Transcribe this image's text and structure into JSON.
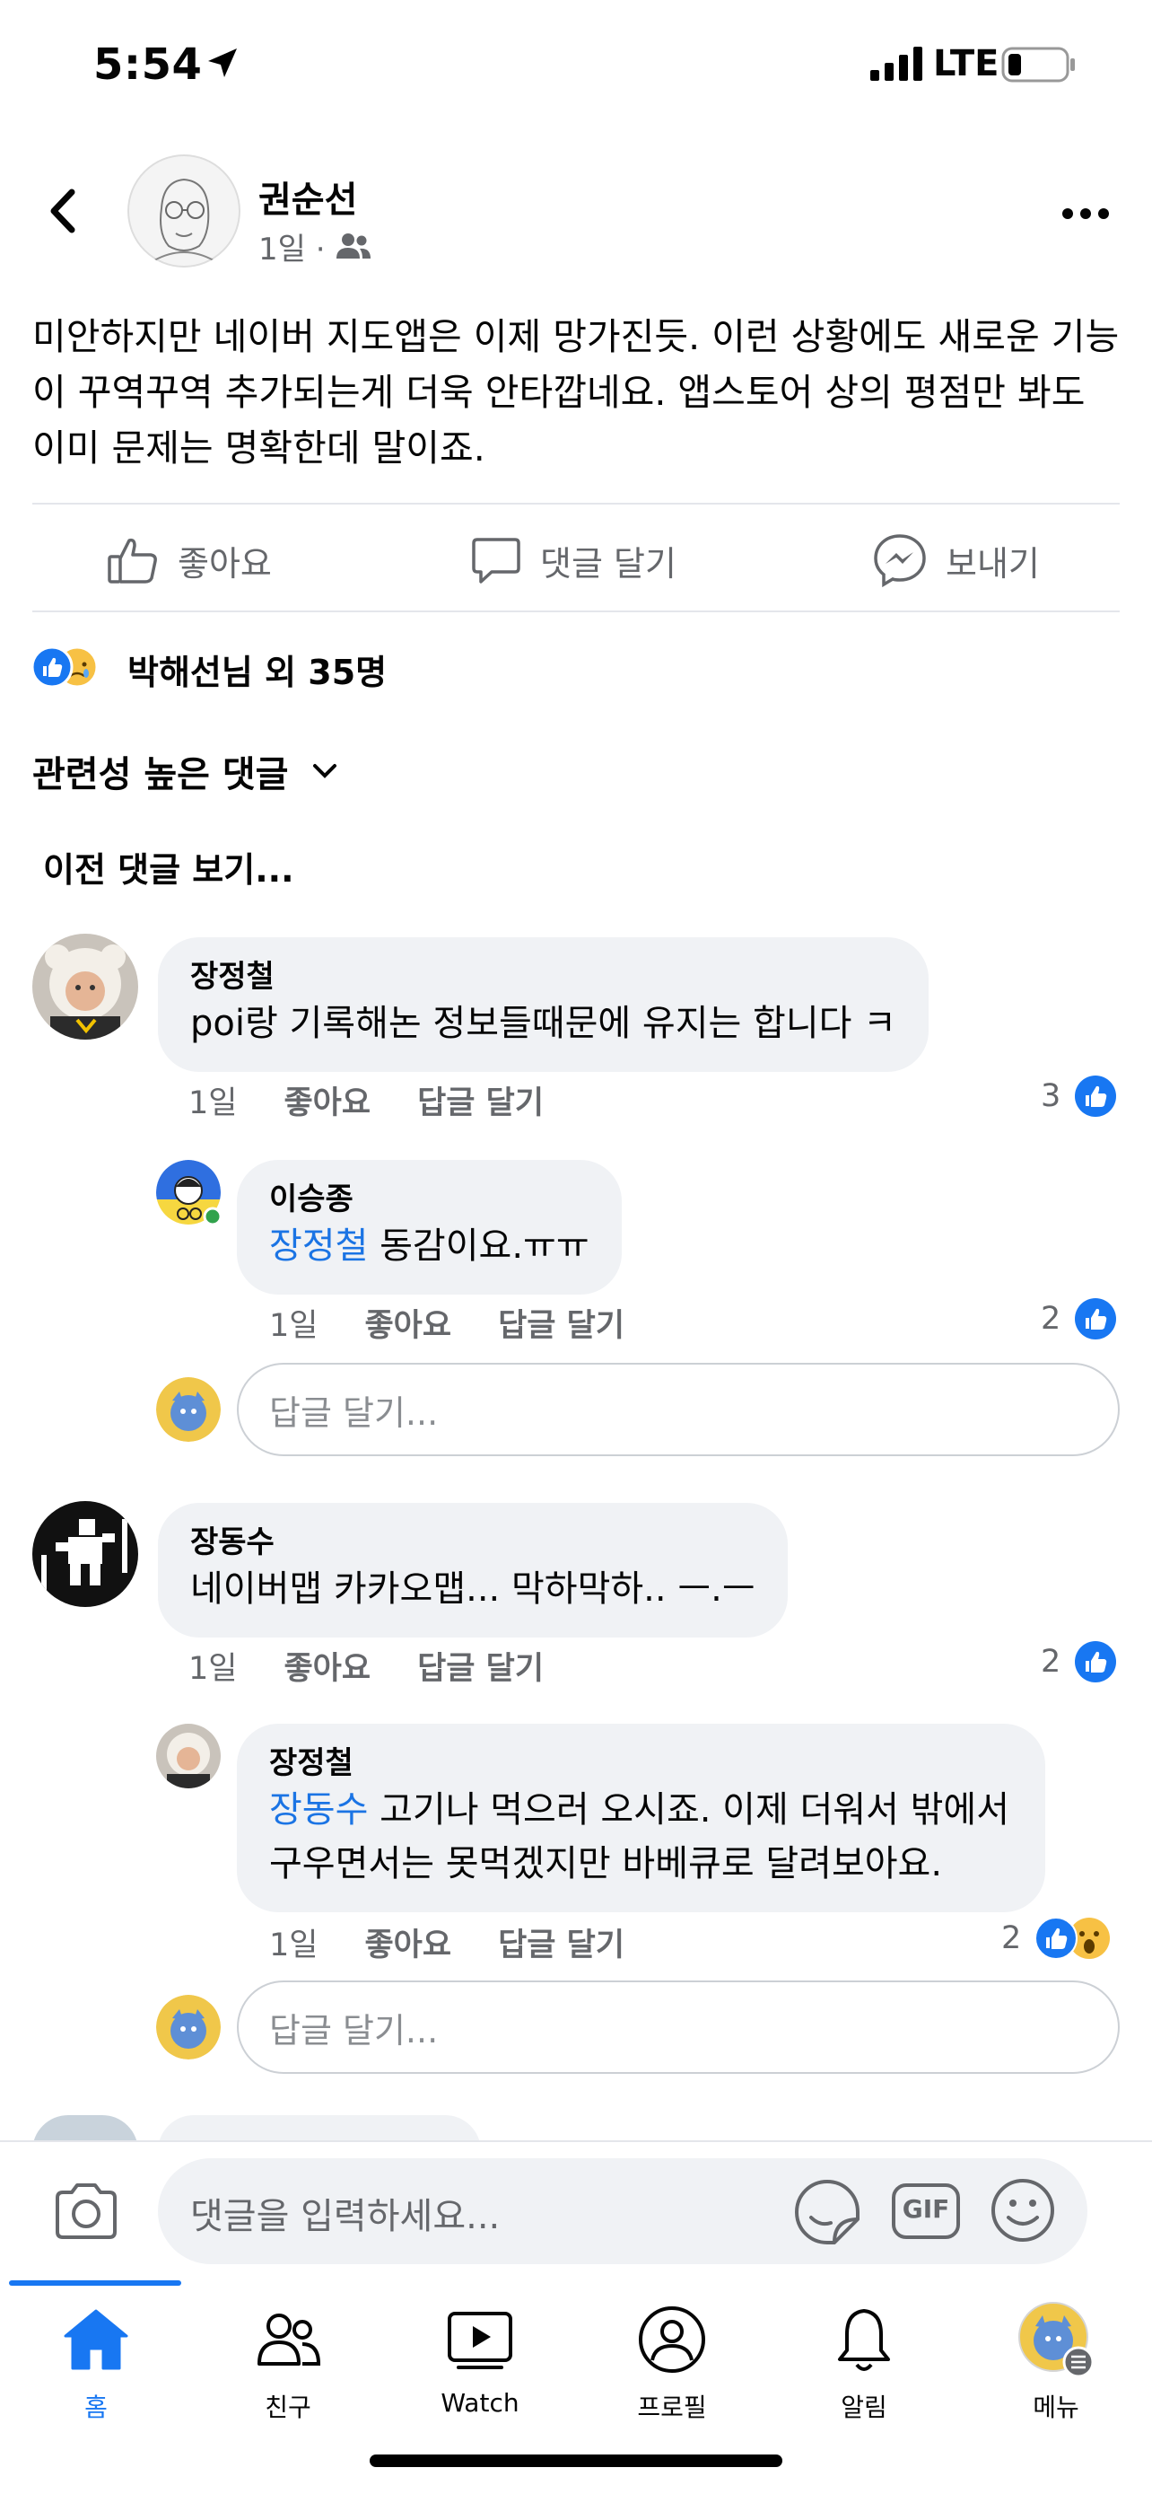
{
  "status_bar": {
    "time": "5:54",
    "network": "LTE"
  },
  "post": {
    "author": "권순선",
    "age": "1일",
    "separator": "·",
    "body": "미안하지만 네이버 지도앱은 이제 망가진듯. 이런 상황에도 새로운 기능이 꾸역꾸역 추가되는게 더욱 안타깝네요. 앱스토어 상의 평점만 봐도 이미 문제는 명확한데 말이죠."
  },
  "actions": {
    "like": "좋아요",
    "comment": "댓글 달기",
    "share": "보내기"
  },
  "reactions": {
    "summary": "박해선님 외 35명"
  },
  "sort": {
    "label": "관련성 높은 댓글"
  },
  "prev_comments": "이전 댓글 보기...",
  "comments": [
    {
      "name": "장정철",
      "text": "poi랑 기록해논 정보들때문에 유지는 합니다 ㅋ",
      "age": "1일",
      "like": "좋아요",
      "reply": "답글 달기",
      "likes": "3"
    },
    {
      "name": "이승종",
      "mention": "장정철",
      "text": " 동감이요.ㅠㅠ",
      "age": "1일",
      "like": "좋아요",
      "reply": "답글 달기",
      "likes": "2"
    },
    {
      "name": "장동수",
      "text": "네이버맵 카카오맵... 막하막하.. ㅡ.ㅡ",
      "age": "1일",
      "like": "좋아요",
      "reply": "답글 달기",
      "likes": "2"
    },
    {
      "name": "장정철",
      "mention": "장동수",
      "text_line1": " 고기나 먹으러 오시죠. 이제 더워서 밖에서",
      "text_line2": "구우면서는 못먹겠지만 바베큐로 달려보아요.",
      "age": "1일",
      "like": "좋아요",
      "reply": "답글 달기",
      "likes": "2"
    }
  ],
  "reply_placeholder": "답글 달기...",
  "comment_bar": {
    "placeholder": "댓글을 입력하세요...",
    "gif": "GIF"
  },
  "tabs": [
    {
      "label": "홈",
      "icon": "home-icon",
      "active": true
    },
    {
      "label": "친구",
      "icon": "friends-icon"
    },
    {
      "label": "Watch",
      "icon": "watch-icon"
    },
    {
      "label": "프로필",
      "icon": "profile-icon"
    },
    {
      "label": "알림",
      "icon": "bell-icon"
    },
    {
      "label": "메뉴",
      "icon": "menu-icon"
    }
  ],
  "colors": {
    "accent": "#1877f2",
    "bubble": "#f0f2f5",
    "muted": "#65676b",
    "mention": "#1b74e4"
  }
}
